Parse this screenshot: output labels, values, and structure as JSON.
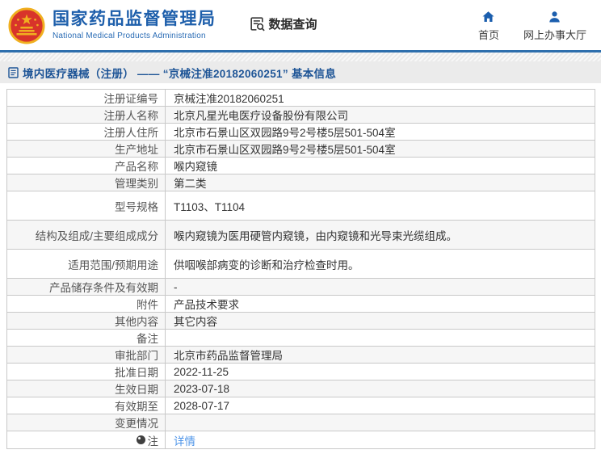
{
  "header": {
    "org_name_cn": "国家药品监督管理局",
    "org_name_en": "National Medical Products Administration",
    "data_query_label": "数据查询",
    "nav": [
      {
        "label": "首页",
        "icon": "home-icon"
      },
      {
        "label": "网上办事大厅",
        "icon": "user-icon"
      }
    ]
  },
  "breadcrumb": {
    "text": "境内医疗器械（注册） —— “京械注准20182060251” 基本信息"
  },
  "table": {
    "rows": [
      {
        "label": "注册证编号",
        "value": "京械注准20182060251"
      },
      {
        "label": "注册人名称",
        "value": "北京凡星光电医疗设备股份有限公司"
      },
      {
        "label": "注册人住所",
        "value": "北京市石景山区双园路9号2号楼5层501-504室"
      },
      {
        "label": "生产地址",
        "value": "北京市石景山区双园路9号2号楼5层501-504室"
      },
      {
        "label": "产品名称",
        "value": "喉内窥镜"
      },
      {
        "label": "管理类别",
        "value": "第二类"
      },
      {
        "label": "型号规格",
        "value": "T1103、T1104",
        "tall": true
      },
      {
        "label": "结构及组成/主要组成成分",
        "value": "喉内窥镜为医用硬管内窥镜，由内窥镜和光导束光缆组成。",
        "tall": true
      },
      {
        "label": "适用范围/预期用途",
        "value": "供咽喉部病变的诊断和治疗检查时用。",
        "tall": true
      },
      {
        "label": "产品储存条件及有效期",
        "value": "-"
      },
      {
        "label": "附件",
        "value": "产品技术要求"
      },
      {
        "label": "其他内容",
        "value": "其它内容"
      },
      {
        "label": "备注",
        "value": ""
      },
      {
        "label": "审批部门",
        "value": "北京市药品监督管理局"
      },
      {
        "label": "批准日期",
        "value": "2022-11-25"
      },
      {
        "label": "生效日期",
        "value": "2023-07-18"
      },
      {
        "label": "有效期至",
        "value": "2028-07-17"
      },
      {
        "label": "变更情况",
        "value": ""
      },
      {
        "label": "注",
        "value": "详情",
        "link": true,
        "icon": "note-icon"
      }
    ]
  },
  "colors": {
    "brand_blue": "#1e5fab",
    "separator_blue": "#2e6fad",
    "breadcrumb_text": "#1d5496",
    "link_blue": "#4d94e8",
    "emblem_red": "#d8342a",
    "emblem_gold": "#f0b020"
  }
}
